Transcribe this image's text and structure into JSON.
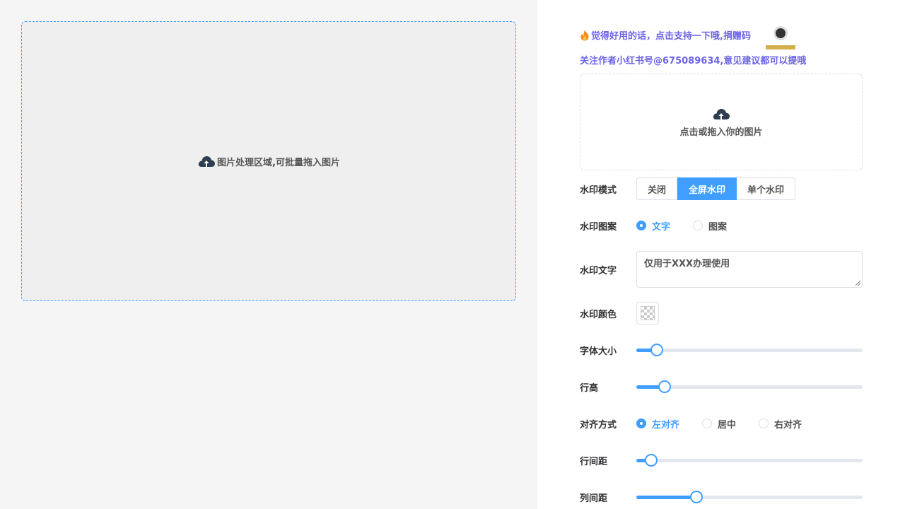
{
  "left": {
    "drop_area_text": "图片处理区域,可批量拖入图片"
  },
  "right": {
    "promo_text": "觉得好用的话，点击支持一下哦,捐赠码",
    "follow_text": "关注作者小红书号@675089634,意见建议都可以提哦",
    "upload_text": "点击或拖入你的图片",
    "watermark_mode": {
      "label": "水印模式",
      "options": [
        "关闭",
        "全屏水印",
        "单个水印"
      ],
      "selected": "全屏水印"
    },
    "watermark_pattern": {
      "label": "水印图案",
      "options": [
        "文字",
        "图案"
      ],
      "selected": "文字"
    },
    "watermark_text": {
      "label": "水印文字",
      "value": "仅用于XXX办理使用"
    },
    "watermark_color": {
      "label": "水印颜色"
    },
    "font_size": {
      "label": "字体大小",
      "level": 0.09
    },
    "line_height": {
      "label": "行高",
      "level": 0.125
    },
    "alignment": {
      "label": "对齐方式",
      "options": [
        "左对齐",
        "居中",
        "右对齐"
      ],
      "selected": "左对齐"
    },
    "row_spacing": {
      "label": "行间距",
      "level": 0.065
    },
    "col_spacing": {
      "label": "列间距",
      "level": 0.265
    }
  },
  "colors": {
    "accent": "#409eff",
    "promo": "#6c63e8",
    "left_bg": "#f5f5f5",
    "drop_bg": "#efefef"
  }
}
